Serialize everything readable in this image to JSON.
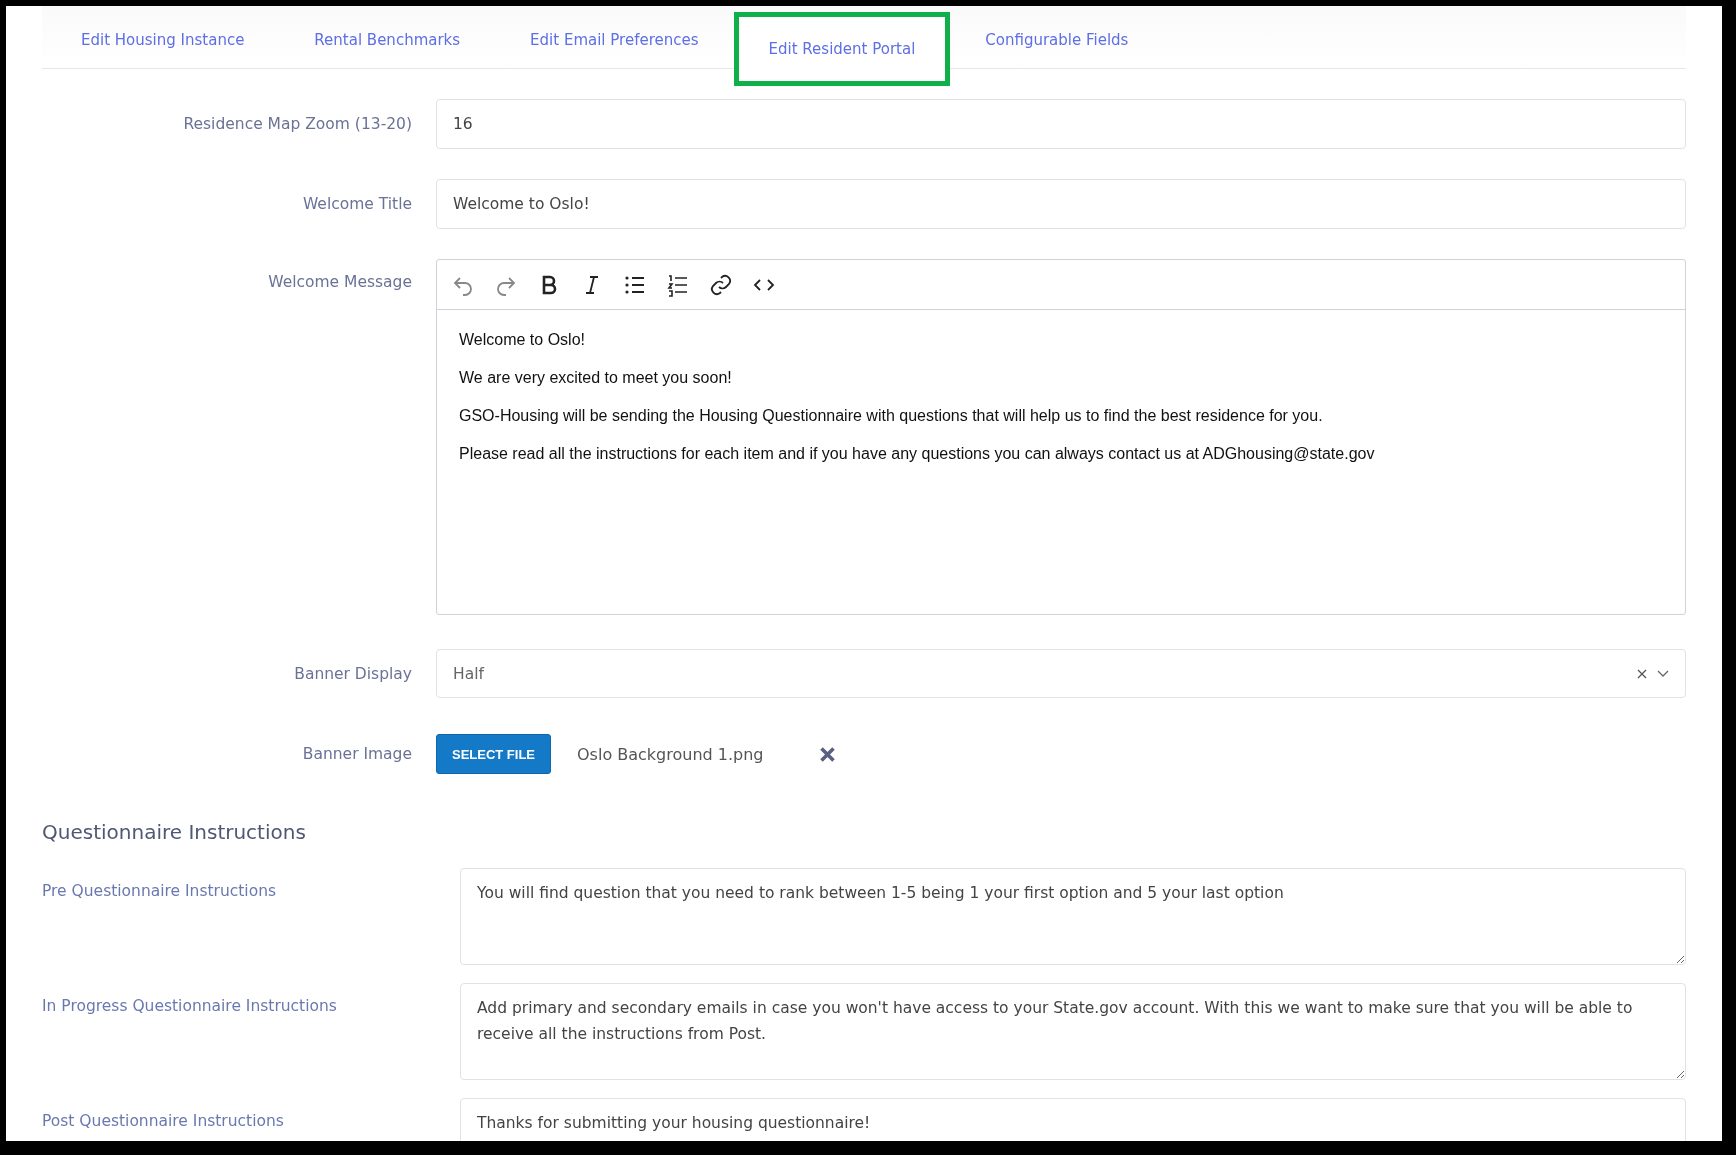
{
  "tabs": [
    {
      "label": "Edit Housing Instance",
      "selected": false
    },
    {
      "label": "Rental Benchmarks",
      "selected": false
    },
    {
      "label": "Edit Email Preferences",
      "selected": false
    },
    {
      "label": "Edit Resident Portal",
      "selected": true
    },
    {
      "label": "Configurable Fields",
      "selected": false
    }
  ],
  "fields": [
    {
      "kind": "text",
      "label": "Residence Map Zoom (13-20)",
      "value": "16"
    },
    {
      "kind": "text",
      "label": "Welcome Title",
      "value": "Welcome to Oslo!"
    },
    {
      "kind": "editor",
      "label": "Welcome Message",
      "paragraphs": [
        "Welcome to Oslo!",
        "We are very excited to meet you soon!",
        "GSO-Housing will be sending the Housing Questionnaire with questions that will help us to find the best residence for you.",
        "Please read all the instructions for each item and if you have any questions you can always contact us at ADGhousing@state.gov"
      ]
    },
    {
      "kind": "select",
      "label": "Banner Display",
      "value": "Half"
    },
    {
      "kind": "file",
      "label": "Banner Image",
      "button": "SELECT FILE",
      "filename": "Oslo Background 1.png"
    }
  ],
  "section_title": "Questionnaire Instructions",
  "instructions": [
    {
      "label": "Pre Questionnaire Instructions",
      "value": "You will find question that you need to rank between 1-5 being 1 your first option and 5 your last option"
    },
    {
      "label": "In Progress Questionnaire Instructions",
      "value": "Add primary and secondary emails in case you won't have access to your State.gov account. With this we want to make sure that you will be able to receive all the instructions from Post."
    },
    {
      "label": "Post Questionnaire Instructions",
      "value": "Thanks for submitting your housing questionnaire!"
    }
  ]
}
